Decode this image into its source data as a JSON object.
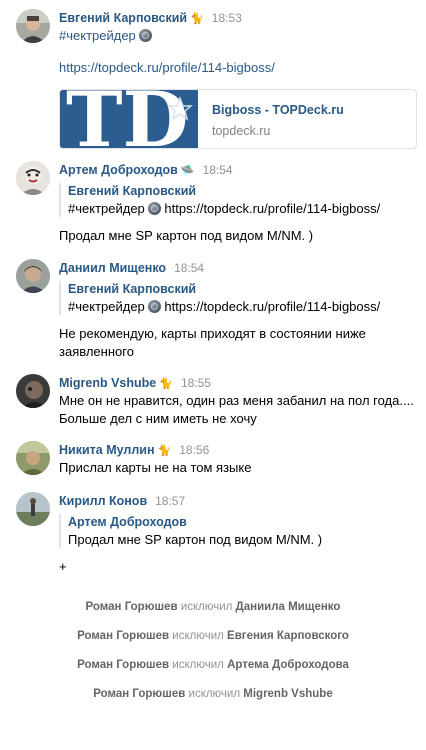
{
  "messages": [
    {
      "author": "Евгений Карповский",
      "badge": "🐈",
      "time": "18:53",
      "hashtag": "#чектрейдер",
      "link": "https://topdeck.ru/profile/114-bigboss/",
      "card": {
        "title": "Bigboss - TOPDeck.ru",
        "domain": "topdeck.ru",
        "logo_text": "TD"
      }
    },
    {
      "author": "Артем Доброходов",
      "badge": "🛸",
      "time": "18:54",
      "quote": {
        "author": "Евгений Карповский",
        "text": "#чектрейдер",
        "link": "https://topdeck.ru/profile/114-bigboss/"
      },
      "text": "Продал мне SP картон под видом M/NM. )"
    },
    {
      "author": "Даниил Мищенко",
      "time": "18:54",
      "quote": {
        "author": "Евгений Карповский",
        "text": "#чектрейдер",
        "link": "https://topdeck.ru/profile/114-bigboss/"
      },
      "text_line1": "Не рекомендую, карты приходят в состоянии ниже",
      "text_line2": "заявленного"
    },
    {
      "author": "Migrenb Vshube",
      "badge": "🐈",
      "time": "18:55",
      "text_line1": "Мне он не нравится, один раз меня забанил на пол года....",
      "text_line2": "Больше дел с ним иметь не хочу"
    },
    {
      "author": "Никита Муллин",
      "badge": "🐈",
      "time": "18:56",
      "text": "Прислал карты не на том языке"
    },
    {
      "author": "Кирилл Конов",
      "time": "18:57",
      "quote": {
        "author": "Артем Доброходов",
        "text": "Продал мне SP картон под видом M/NM. )"
      },
      "text": "+"
    }
  ],
  "system": [
    {
      "actor": "Роман Горюшев",
      "action": "исключил",
      "target": "Даниила Мищенко"
    },
    {
      "actor": "Роман Горюшев",
      "action": "исключил",
      "target": "Евгения Карповского"
    },
    {
      "actor": "Роман Горюшев",
      "action": "исключил",
      "target": "Артема Доброходова"
    },
    {
      "actor": "Роман Горюшев",
      "action": "исключил",
      "target": "Migrenb Vshube"
    }
  ],
  "colors": {
    "link": "#2a5885",
    "time": "#939393",
    "card_image": "#2c5d91"
  },
  "icons": {
    "hashtag_emoji": "crystal-ball-icon",
    "badge": "cat-icon",
    "badge_alt": "ufo-icon"
  }
}
